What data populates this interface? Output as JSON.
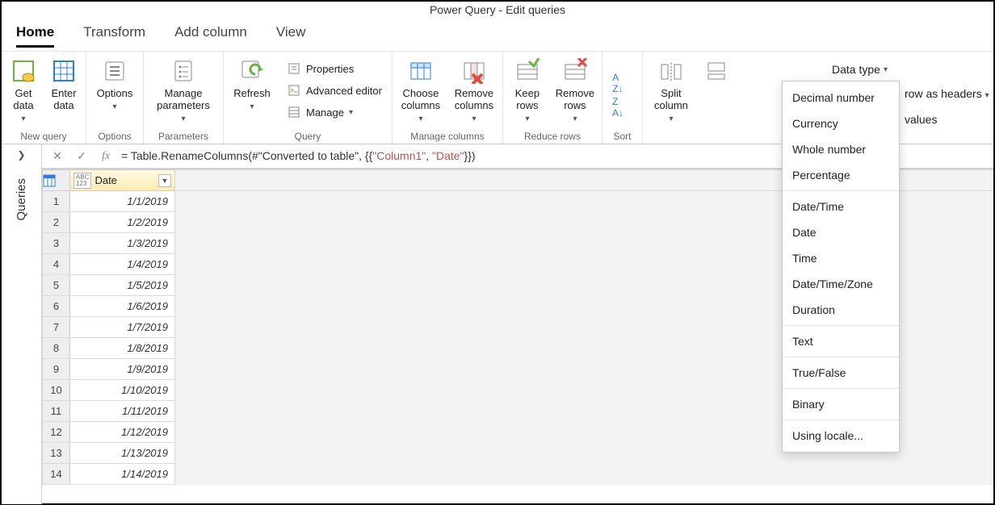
{
  "title": "Power Query - Edit queries",
  "tabs": {
    "home": "Home",
    "transform": "Transform",
    "add_column": "Add column",
    "view": "View"
  },
  "ribbon": {
    "new_query": {
      "label": "New query",
      "get_data": "Get data",
      "enter_data": "Enter data"
    },
    "options": {
      "label": "Options",
      "options": "Options"
    },
    "parameters": {
      "label": "Parameters",
      "manage": "Manage parameters"
    },
    "query": {
      "label": "Query",
      "refresh": "Refresh",
      "properties": "Properties",
      "advanced": "Advanced editor",
      "manage": "Manage"
    },
    "manage_cols": {
      "label": "Manage columns",
      "choose": "Choose columns",
      "remove": "Remove columns"
    },
    "reduce": {
      "label": "Reduce rows",
      "keep": "Keep rows",
      "remove": "Remove rows"
    },
    "sort": {
      "label": "Sort"
    },
    "split": "Split column",
    "data_type": "Data type",
    "use_row": "row as headers",
    "values": "values"
  },
  "queries_panel": "Queries",
  "formula": {
    "prefix": "= Table.RenameColumns(#\"Converted to table\", {{",
    "s1": "\"Column1\"",
    "sep": ", ",
    "s2": "\"Date\"",
    "suffix": "}})"
  },
  "column": {
    "type_label_top": "ABC",
    "type_label_bot": "123",
    "name": "Date"
  },
  "rows": [
    "1/1/2019",
    "1/2/2019",
    "1/3/2019",
    "1/4/2019",
    "1/5/2019",
    "1/6/2019",
    "1/7/2019",
    "1/8/2019",
    "1/9/2019",
    "1/10/2019",
    "1/11/2019",
    "1/12/2019",
    "1/13/2019",
    "1/14/2019"
  ],
  "datatype_menu": {
    "g1": [
      "Decimal number",
      "Currency",
      "Whole number",
      "Percentage"
    ],
    "g2": [
      "Date/Time",
      "Date",
      "Time",
      "Date/Time/Zone",
      "Duration"
    ],
    "g3": [
      "Text"
    ],
    "g4": [
      "True/False"
    ],
    "g5": [
      "Binary"
    ],
    "g6": [
      "Using locale..."
    ]
  }
}
